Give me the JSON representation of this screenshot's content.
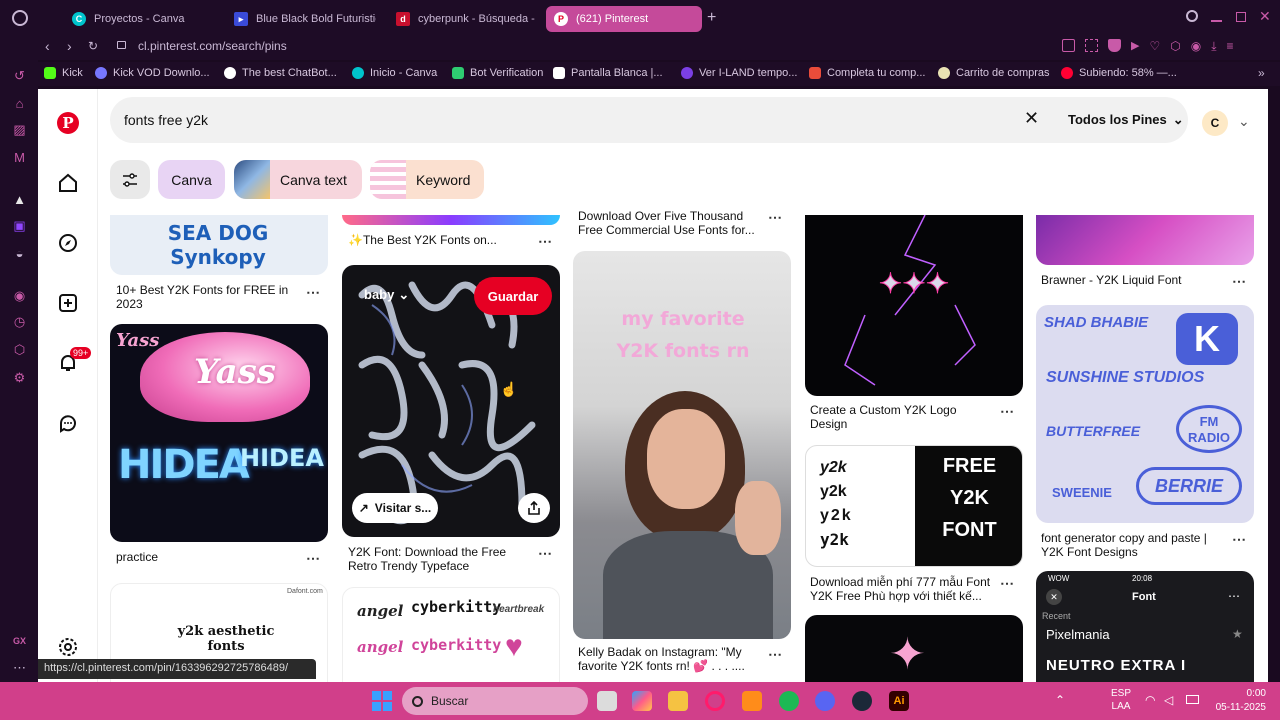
{
  "tabs": [
    {
      "label": "Proyectos - Canva",
      "icon": "canva-icon"
    },
    {
      "label": "Blue Black Bold Futuristic",
      "icon": "canva-doc-icon"
    },
    {
      "label": "cyberpunk - Búsqueda -",
      "icon": "dafont-icon"
    },
    {
      "label": "(621) Pinterest",
      "icon": "pinterest-icon"
    }
  ],
  "address": {
    "url": "cl.pinterest.com/search/pins"
  },
  "bookmarks": [
    {
      "label": "Kick",
      "color": "#53fc18"
    },
    {
      "label": "Kick VOD Downlo...",
      "color": "#7777ff"
    },
    {
      "label": "The best ChatBot...",
      "color": "#ffffff"
    },
    {
      "label": "Inicio - Canva",
      "color": "#00c4cc"
    },
    {
      "label": "Bot Verification",
      "color": "#2ecc71"
    },
    {
      "label": "Pantalla Blanca |...",
      "color": "#ffffff"
    },
    {
      "label": "Ver I-LAND tempo...",
      "color": "#7b3fe4"
    },
    {
      "label": "Completa tu comp...",
      "color": "#e94c3a"
    },
    {
      "label": "Carrito de compras",
      "color": "#e9e2b3"
    },
    {
      "label": "Subiendo: 58% —...",
      "color": "#ff0033"
    }
  ],
  "search": {
    "query": "fonts free y2k",
    "filter_label": "Todos los Pines",
    "avatar": "C"
  },
  "chips": [
    {
      "label": "Canva"
    },
    {
      "label": "Canva text"
    },
    {
      "label": "Keyword"
    }
  ],
  "notifications": {
    "badge": "99+"
  },
  "pins": {
    "col1_top": {
      "title": "10+ Best Y2K Fonts for FREE in 2023",
      "art": "SEA DOG Synkopy"
    },
    "col1_mid": {
      "title": "practice",
      "art_words": [
        "Yass",
        "Yass",
        "HIDEA",
        "HIDEA"
      ]
    },
    "col1_bot": {
      "art": "y2k aesthetic fonts",
      "source": "Dafont.com"
    },
    "col2_top": {
      "title": "✨The Best Y2K Fonts on..."
    },
    "col2_mid": {
      "title": "Y2K Font: Download the Free Retro Trendy Typeface",
      "board": "baby",
      "save": "Guardar",
      "visit": "Visitar s..."
    },
    "col2_bot": {
      "art_words": [
        "angel",
        "cyberkitty",
        "heartbreak"
      ]
    },
    "col3_top": {
      "title": "Download Over Five Thousand Free Commercial Use Fonts for..."
    },
    "col3_mid": {
      "title": "Kelly Badak on Instagram: \"My favorite Y2K fonts rn! 💕 . . . ....",
      "overlay": "my favorite Y2K fonts rn"
    },
    "col4_top": {
      "title": "Create a Custom Y2K Logo Design"
    },
    "col4_mid": {
      "title": "Download miễn phí 777 mẫu Font Y2K Free Phù hợp với thiết kế...",
      "words": [
        "y2k",
        "y2k",
        "y2k",
        "y2k"
      ],
      "right": [
        "FREE",
        "Y2K",
        "FONT"
      ]
    },
    "col5_top": {
      "title": "Brawner - Y2K Liquid Font"
    },
    "col5_mid": {
      "title": "font generator copy and paste | Y2K Font Designs",
      "words": [
        "SHAD BHABIE",
        "SUNSHINE STUDIOS",
        "BUTTERFREE",
        "FM RADIO",
        "SWEENIE",
        "BERRIE"
      ]
    },
    "col5_bot": {
      "time": "20:08",
      "carrier": "WOW",
      "header": "Font",
      "recent": "Recent",
      "item1": "Pixelmania",
      "item2": "NEUTRO EXTRA I"
    }
  },
  "status_url": "https://cl.pinterest.com/pin/163396292725786489/",
  "taskbar": {
    "search": "Buscar",
    "lang1": "ESP",
    "lang2": "LAA",
    "time": "0:00",
    "date": "05-11-2025"
  },
  "colors": {
    "pinterest_red": "#e60023",
    "taskbar": "#d13f8a",
    "browser": "#1e0c26"
  }
}
